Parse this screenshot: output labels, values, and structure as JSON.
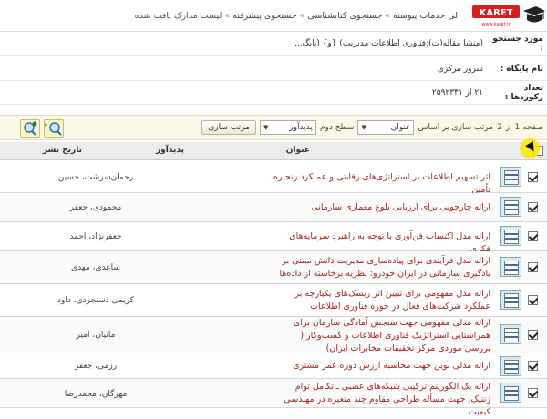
{
  "breadcrumb": {
    "items": [
      "لی خدمات پیوسته",
      "جستجوی کتابشناسی",
      "جستجوی پیشرفته",
      "لیست مدارک یافت شده"
    ],
    "separator": "»"
  },
  "logo": {
    "text": "KARET",
    "tagline": "www.karet.ir"
  },
  "info": {
    "search_label": "مورد جستجو :",
    "search_value": "(منشا مقاله(ت):فناوری اطلاعات مدیریت) {و} (پایگ...",
    "db_label": "نام پایگاه :",
    "db_value": "سرور مرکزی",
    "count_label": "تعداد رکوردها :",
    "count_value": "۲۱ از ۲۵۹۲۳۴۱"
  },
  "toolbar": {
    "page_label": "صفحه 1 از",
    "page_total": "2",
    "sort_label": "مرتب سازی بر اساس",
    "sort1_value": "عنوان",
    "level2_label": "سطح دوم",
    "sort2_value": "پدیدآور",
    "sort_button": "مرتب سازی"
  },
  "columns": {
    "title": "عنوان",
    "author": "پدیدآور",
    "date": "تاریخ نشر"
  },
  "rows": [
    {
      "title": "اثر تسهیم اطلاعات بر استراتژی‌های رقابتی و عملکرد زنجیره تأمین",
      "author": "رحمان‌سرشت، حسین"
    },
    {
      "title": "ارائه چارچوبی برای ارزیابی بلوغ معماری سازمانی",
      "author": "محمودی، جعفر"
    },
    {
      "title": "ارائه مدل اکتساب فن‌آوری با توجه به راهبرد سرمایه‌های فکری",
      "author": "جعفرنژاد، احمد"
    },
    {
      "title": "ارائه مدل فرآیندی برای پیاده‌سازی مدیریت دانش مبتنی بر یادگیری سازمانی در ایران خودرو: نظریه برخاسته از داده‌ها",
      "author": "ساعدی، مهدی"
    },
    {
      "title": "ارائه مدل مفهومی برای تبیین اثر ریسک‌های یکپارچه بر عملکرد شرکت‌های فعال در حوزه فناوری اطلاعات",
      "author": "کریمی دستجردی، داود"
    },
    {
      "title": "ارائه مدلی مفهومی جهت سنجش آمادگی سازمان برای همراستایی استراتژیک فناوری اطلاعات و کسب‌وکار ( بررسی موردی مرکز تحقیقات مخابرات ایران)",
      "author": "ماتیان، امیر"
    },
    {
      "title": "ارائه مدلی نوین جهت محاسبه ارزش دوره عمر مشتری",
      "author": "رزمی، جعفر"
    },
    {
      "title": "ارائه یک الگوریتم ترکیبی شبکه‌های عصبی ـ تکامل توام ژنتیک، جهت مسأله طراحی مقاوم چند متغیره در مهندسی کیفیت",
      "author": "مهرگان، محمدرضا"
    }
  ]
}
